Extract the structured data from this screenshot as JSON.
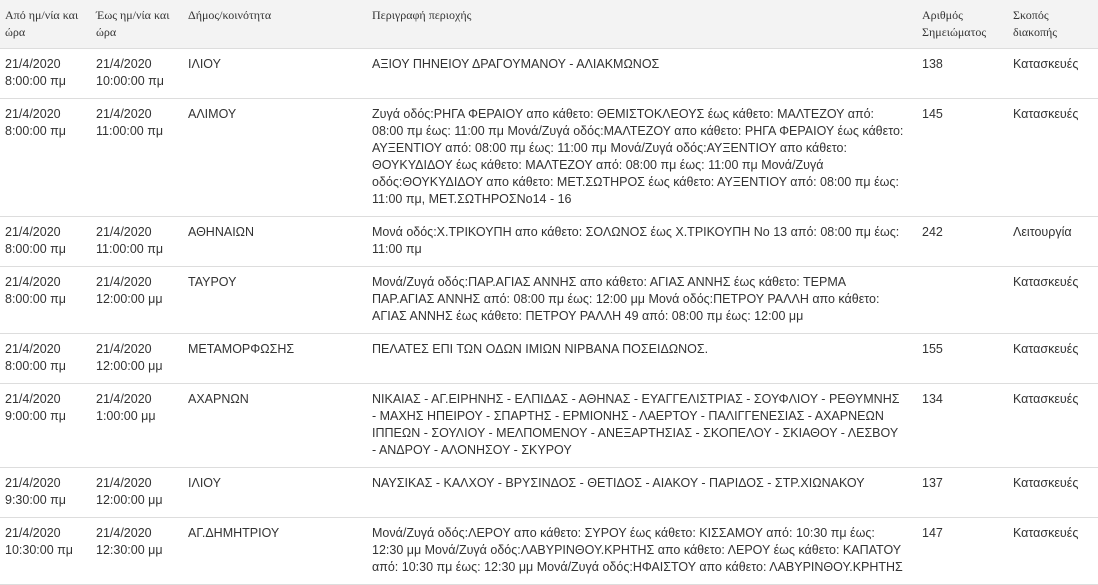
{
  "table": {
    "headers": {
      "from": "Από ημ/νία και ώρα",
      "to": "Έως ημ/νία και ώρα",
      "municipality": "Δήμος/κοινότητα",
      "description": "Περιγραφή περιοχής",
      "notice_number": "Αριθμός Σημειώματος",
      "purpose": "Σκοπός διακοπής"
    },
    "rows": [
      {
        "from": "21/4/2020 8:00:00 πμ",
        "to": "21/4/2020 10:00:00 πμ",
        "municipality": "ΙΛΙΟΥ",
        "description": "ΑΞΙΟΥ ΠΗΝΕΙΟΥ ΔΡΑΓΟΥΜΑΝΟΥ - ΑΛΙΑΚΜΩΝΟΣ",
        "notice_number": "138",
        "purpose": "Κατασκευές"
      },
      {
        "from": "21/4/2020 8:00:00 πμ",
        "to": "21/4/2020 11:00:00 πμ",
        "municipality": "ΑΛΙΜΟΥ",
        "description": "Ζυγά οδός:ΡΗΓΑ ΦΕΡΑΙΟΥ απο κάθετο: ΘΕΜΙΣΤΟΚΛΕΟΥΣ έως κάθετο: ΜΑΛΤΕΖΟΥ από: 08:00 πμ έως: 11:00 πμ Μονά/Ζυγά οδός:ΜΑΛΤΕΖΟΥ απο κάθετο: ΡΗΓΑ ΦΕΡΑΙΟΥ έως κάθετο: ΑΥΞΕΝΤΙΟΥ από: 08:00 πμ έως: 11:00 πμ Μονά/Ζυγά οδός:ΑΥΞΕΝΤΙΟΥ απο κάθετο: ΘΟΥΚΥΔΙΔΟΥ έως κάθετο: ΜΑΛΤΕΖΟΥ από: 08:00 πμ έως: 11:00 πμ Μονά/Ζυγά οδός:ΘΟΥΚΥΔΙΔΟΥ απο κάθετο: ΜΕΤ.ΣΩΤΗΡΟΣ έως κάθετο: ΑΥΞΕΝΤΙΟΥ από: 08:00 πμ έως: 11:00 πμ, ΜΕΤ.ΣΩΤΗΡΟΣΝο14 - 16",
        "notice_number": "145",
        "purpose": "Κατασκευές"
      },
      {
        "from": "21/4/2020 8:00:00 πμ",
        "to": "21/4/2020 11:00:00 πμ",
        "municipality": "ΑΘΗΝΑΙΩΝ",
        "description": "Μονά οδός:Χ.ΤΡΙΚΟΥΠΗ απο κάθετο: ΣΟΛΩΝΟΣ έως Χ.ΤΡΙΚΟΥΠΗ Νο 13 από: 08:00 πμ έως: 11:00 πμ",
        "notice_number": "242",
        "purpose": "Λειτουργία"
      },
      {
        "from": "21/4/2020 8:00:00 πμ",
        "to": "21/4/2020 12:00:00 μμ",
        "municipality": "ΤΑΥΡΟΥ",
        "description": "Μονά/Ζυγά οδός:ΠΑΡ.ΑΓΙΑΣ ΑΝΝΗΣ απο κάθετο: ΑΓΙΑΣ ΑΝΝΗΣ έως κάθετο: ΤΕΡΜΑ ΠΑΡ.ΑΓΙΑΣ ΑΝΝΗΣ από: 08:00 πμ έως: 12:00 μμ Μονά οδός:ΠΕΤΡΟΥ ΡΑΛΛΗ απο κάθετο: ΑΓΙΑΣ ΑΝΝΗΣ έως κάθετο: ΠΕΤΡΟΥ ΡΑΛΛΗ 49 από: 08:00 πμ έως: 12:00 μμ",
        "notice_number": "",
        "purpose": "Κατασκευές"
      },
      {
        "from": "21/4/2020 8:00:00 πμ",
        "to": "21/4/2020 12:00:00 μμ",
        "municipality": "ΜΕΤΑΜΟΡΦΩΣΗΣ",
        "description": "ΠΕΛΑΤΕΣ ΕΠΙ ΤΩΝ ΟΔΩΝ ΙΜΙΩΝ ΝΙΡΒΑΝΑ ΠΟΣΕΙΔΩΝΟΣ.",
        "notice_number": "155",
        "purpose": "Κατασκευές"
      },
      {
        "from": "21/4/2020 9:00:00 πμ",
        "to": "21/4/2020 1:00:00 μμ",
        "municipality": "ΑΧΑΡΝΩΝ",
        "description": "ΝΙΚΑΙΑΣ - ΑΓ.ΕΙΡΗΝΗΣ - ΕΛΠΙΔΑΣ - ΑΘΗΝΑΣ - ΕΥΑΓΓΕΛΙΣΤΡΙΑΣ - ΣΟΥΦΛΙΟΥ - ΡΕΘΥΜΝΗΣ - ΜΑΧΗΣ ΗΠΕΙΡΟΥ - ΣΠΑΡΤΗΣ - ΕΡΜΙΟΝΗΣ - ΛΑΕΡΤΟΥ - ΠΑΛΙΓΓΕΝΕΣΙΑΣ - ΑΧΑΡΝΕΩΝ ΙΠΠΕΩΝ - ΣΟΥΛΙΟΥ - ΜΕΛΠΟΜΕΝΟΥ - ΑΝΕΞΑΡΤΗΣΙΑΣ - ΣΚΟΠΕΛΟΥ - ΣΚΙΑΘΟΥ - ΛΕΣΒΟΥ - ΑΝΔΡΟΥ - ΑΛΟΝΗΣΟΥ - ΣΚΥΡΟΥ",
        "notice_number": "134",
        "purpose": "Κατασκευές"
      },
      {
        "from": "21/4/2020 9:30:00 πμ",
        "to": "21/4/2020 12:00:00 μμ",
        "municipality": "ΙΛΙΟΥ",
        "description": "ΝΑΥΣΙΚΑΣ - ΚΑΛΧΟΥ - ΒΡΥΣΙΝΔΟΣ - ΘΕΤΙΔΟΣ - ΑΙΑΚΟΥ - ΠΑΡΙΔΟΣ - ΣΤΡ.ΧΙΩΝΑΚΟΥ",
        "notice_number": "137",
        "purpose": "Κατασκευές"
      },
      {
        "from": "21/4/2020 10:30:00 πμ",
        "to": "21/4/2020 12:30:00 μμ",
        "municipality": "ΑΓ.ΔΗΜΗΤΡΙΟΥ",
        "description": "Μονά/Ζυγά οδός:ΛΕΡΟΥ απο κάθετο: ΣΥΡΟΥ έως κάθετο: ΚΙΣΣΑΜΟΥ από: 10:30 πμ έως: 12:30 μμ Μονά/Ζυγά οδός:ΛΑΒΥΡΙΝΘΟΥ.ΚΡΗΤΗΣ απο κάθετο: ΛΕΡΟΥ έως κάθετο: ΚΑΠΑΤΟΥ από: 10:30 πμ έως: 12:30 μμ Μονά/Ζυγά οδός:ΗΦΑΙΣΤΟΥ απο κάθετο: ΛΑΒΥΡΙΝΘΟΥ.ΚΡΗΤΗΣ",
        "notice_number": "147",
        "purpose": "Κατασκευές"
      }
    ]
  }
}
